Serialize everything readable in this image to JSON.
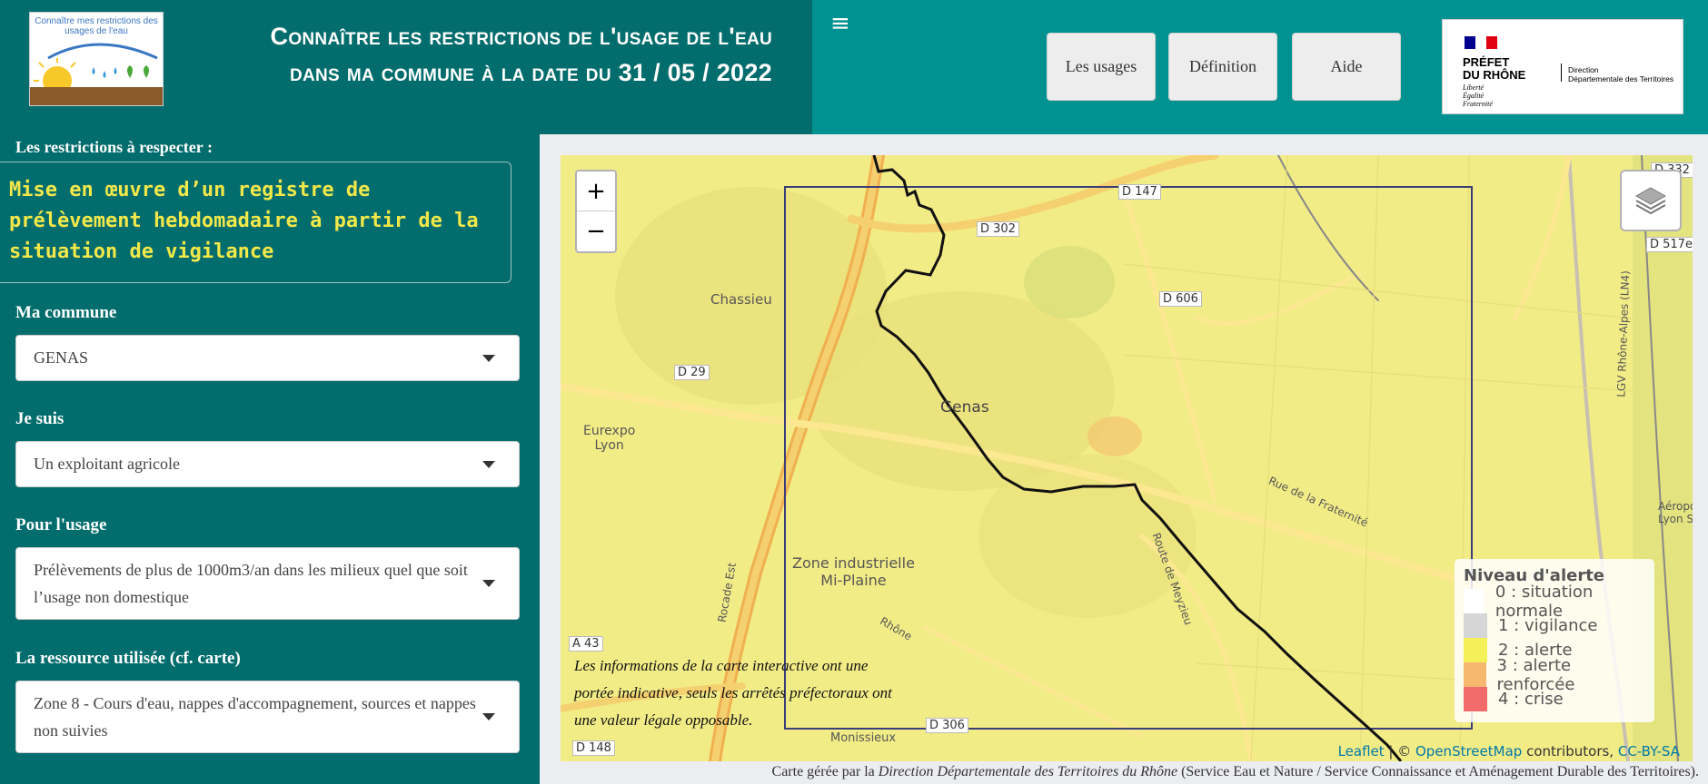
{
  "header": {
    "logo_text": "Connaître mes restrictions des usages de l'eau",
    "title_line1": "Connaître les restrictions de l'usage de l'eau",
    "title_line2": "dans ma commune à la date du 31 / 05 / 2022",
    "hamburger_icon": "≡",
    "nav": [
      "Les usages",
      "Définition",
      "Aide"
    ],
    "prefet_main": "PRÉFET\nDU RHÔNE",
    "prefet_motto": "Liberté\nÉgalité\nFraternité",
    "prefet_direction": "Direction\nDépartementale des Territoires",
    "flag_colors": [
      "#000091",
      "#ffffff",
      "#e1000f"
    ]
  },
  "sidebar": {
    "restrictions_label": "Les restrictions à respecter :",
    "restriction_text": "Mise en œuvre d’un registre de prélèvement hebdomadaire à partir de la situation de vigilance",
    "commune_label": "Ma commune",
    "commune_value": "GENAS",
    "jesuis_label": "Je suis",
    "jesuis_value": "Un exploitant agricole",
    "usage_label": "Pour l'usage",
    "usage_value": "Prélèvements de plus de 1000m3/an dans les milieux quel que soit l’usage non domestique",
    "ressource_label": "La ressource utilisée (cf. carte)",
    "ressource_value": "Zone 8 - Cours d'eau, nappes d'accompagnement, sources et nappes non suivies"
  },
  "map": {
    "zoom_in": "+",
    "zoom_out": "−",
    "places": [
      "Chassieu",
      "Genas",
      "Eurexpo\nLyon",
      "Zone industrielle\nMi-Plaine",
      "Monissieux"
    ],
    "roads": [
      "D 302",
      "D 147",
      "D 606",
      "D 29",
      "D 306",
      "D 148",
      "A 43",
      "D 517e",
      "D 332"
    ],
    "street_labels": [
      "Rue de la Fraternité",
      "Route de Meyzieu",
      "Rocade Est",
      "Rhône",
      "LGV Rhône-Alpes (LN4)",
      "Aéroport\nLyon Sai"
    ],
    "disclaimer": "Les informations de la carte interactive ont une portée indicative, seuls les arrêtés préfectoraux ont une valeur légale opposable.",
    "legend": {
      "title": "Niveau d'alerte",
      "items": [
        {
          "label": "0 : situation normale",
          "color": "#ffffff"
        },
        {
          "label": "1 : vigilance",
          "color": "#d6d6d6"
        },
        {
          "label": "2 : alerte",
          "color": "#f5ef5a"
        },
        {
          "label": "3 : alerte renforcée",
          "color": "#f5b86e"
        },
        {
          "label": "4 : crise",
          "color": "#f26b6b"
        }
      ]
    },
    "attribution_leaflet": "Leaflet",
    "attribution_sep": " | © ",
    "attribution_osm": "OpenStreetMap",
    "attribution_mid": " contributors, ",
    "attribution_cc": "CC-BY-SA"
  },
  "footer": {
    "prefix": "Carte gérée par la ",
    "org": "Direction Départementale des Territoires du Rhône",
    "suffix": " (Service Eau et Nature / Service Connaissance et Aménagement Durable des Territoires)."
  }
}
